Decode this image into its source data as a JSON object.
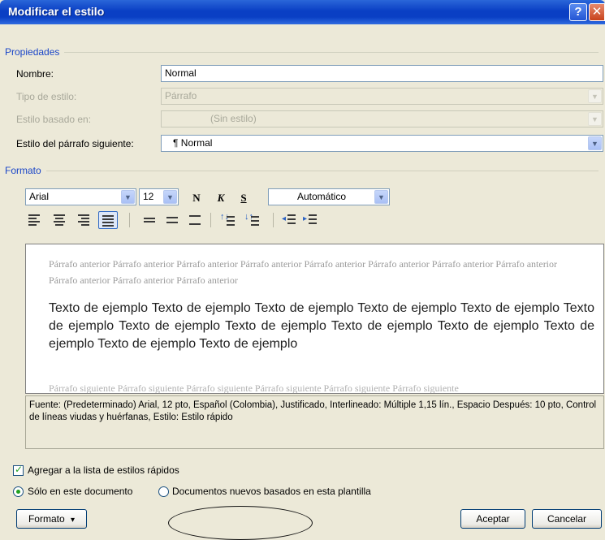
{
  "window": {
    "title": "Modificar el estilo",
    "help_glyph": "?",
    "close_glyph": "✕"
  },
  "properties": {
    "section_label": "Propiedades",
    "name_label": "Nombre:",
    "name_value": "Normal",
    "style_type_label": "Tipo de estilo:",
    "style_type_value": "Párrafo",
    "based_on_label": "Estilo basado en:",
    "based_on_value": "(Sin estilo)",
    "next_style_label": "Estilo del párrafo siguiente:",
    "next_style_value": "¶ Normal"
  },
  "format": {
    "section_label": "Formato",
    "font": "Arial",
    "size": "12",
    "bold": "N",
    "italic": "K",
    "underline": "S",
    "color": "Automático"
  },
  "toolbar_icons": [
    "align-left-icon",
    "align-center-icon",
    "align-right-icon",
    "justify-icon",
    "single-spacing-icon",
    "one-half-spacing-icon",
    "double-spacing-icon",
    "increase-spacing-before-icon",
    "decrease-spacing-before-icon",
    "decrease-indent-icon",
    "increase-indent-icon"
  ],
  "preview": {
    "previous_paragraph": "Párrafo anterior Párrafo anterior Párrafo anterior Párrafo anterior Párrafo anterior Párrafo anterior Párrafo anterior Párrafo anterior Párrafo anterior Párrafo anterior Párrafo anterior",
    "sample_text": "Texto de ejemplo Texto de ejemplo Texto de ejemplo Texto de ejemplo Texto de ejemplo Texto de ejemplo Texto de ejemplo Texto de ejemplo Texto de ejemplo Texto de ejemplo Texto de ejemplo Texto de ejemplo Texto de ejemplo",
    "next_paragraph": "Párrafo siguiente Párrafo siguiente Párrafo siguiente Párrafo siguiente Párrafo siguiente Párrafo siguiente"
  },
  "description": "Fuente: (Predeterminado) Arial, 12 pto, Español (Colombia), Justificado, Interlineado:  Múltiple 1,15 lín., Espacio Después:  10 pto, Control de líneas viudas y huérfanas, Estilo: Estilo rápido",
  "options": {
    "add_quick_styles": "Agregar a la lista de estilos rápidos",
    "add_quick_styles_checked": true,
    "only_this_doc": "Sólo en este documento",
    "new_docs": "Documentos nuevos basados en esta plantilla",
    "selected_scope": "only_this_doc"
  },
  "buttons": {
    "format": "Formato",
    "format_arrow": "▾",
    "ok": "Aceptar",
    "cancel": "Cancelar"
  },
  "colors": {
    "titlebar": "#0a3fc4",
    "section_label": "#1b46c8",
    "dialog_bg": "#ece9d8",
    "check_green": "#21a121"
  }
}
